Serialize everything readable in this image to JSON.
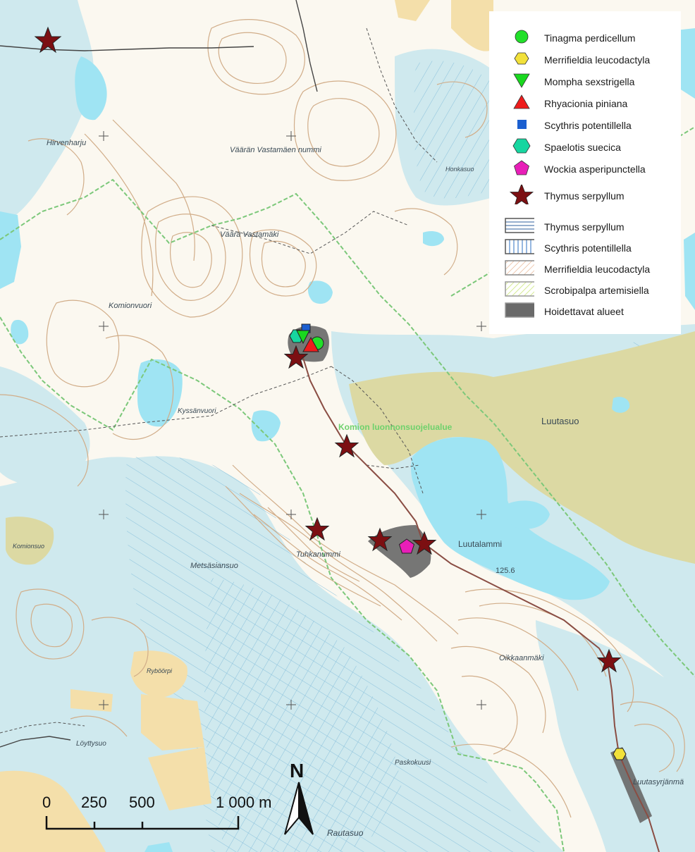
{
  "map": {
    "place_labels": {
      "hirvenharju": "Hirvenharju",
      "vaaran_vastamaen_nummi": "Väärän Vastamäen nummi",
      "vaara_vastamaki": "Väärä Vastamäki",
      "komionvuori": "Komionvuori",
      "honkasuo": "Honkasuo",
      "kyssanvuori": "Kyssänvuori",
      "luutasuo": "Luutasuo",
      "komion_luonnonsuojelualue": "Komion luonnonsuojelualue",
      "komionsuo": "Komionsuo",
      "metsasiansuo": "Metsäsiansuo",
      "tuhkanummi": "Tuhkanummi",
      "luutalammi": "Luutalammi",
      "lake_level": "125.6",
      "oikkaanmaki": "Oikkaanmäki",
      "rybiorpi": "Ryböörpi",
      "loyttysuo": "Löyttysuo",
      "paskokuusi": "Paskokuusi",
      "rautasuo": "Rautasuo",
      "luutasyrjanma": "Luutasyrjänmä"
    },
    "species_markers": [
      {
        "species": "Tinagma perdicellum",
        "shape": "circle",
        "color": "#22e02a"
      },
      {
        "species": "Merrifieldia leucodactyla",
        "shape": "hexagon",
        "color": "#f2e13a"
      },
      {
        "species": "Mompha sexstrigella",
        "shape": "triangle-down",
        "color": "#19d81f"
      },
      {
        "species": "Rhyacionia piniana",
        "shape": "triangle-up",
        "color": "#ee1c1c"
      },
      {
        "species": "Scythris potentillella",
        "shape": "square",
        "color": "#1b5fd0"
      },
      {
        "species": "Spaelotis suecica",
        "shape": "hexagon",
        "color": "#17d6a0"
      },
      {
        "species": "Wockia asperipunctella",
        "shape": "pentagon",
        "color": "#e81eb8"
      },
      {
        "species": "Thymus serpyllum",
        "shape": "star",
        "color": "#7c0f12"
      }
    ]
  },
  "legend": {
    "point_items": [
      {
        "label": "Tinagma perdicellum",
        "icon": "green-circle-icon"
      },
      {
        "label": "Merrifieldia leucodactyla",
        "icon": "yellow-hexagon-icon"
      },
      {
        "label": "Mompha sexstrigella",
        "icon": "green-triangle-down-icon"
      },
      {
        "label": "Rhyacionia piniana",
        "icon": "red-triangle-up-icon"
      },
      {
        "label": "Scythris potentillella",
        "icon": "blue-square-icon"
      },
      {
        "label": "Spaelotis suecica",
        "icon": "teal-hexagon-icon"
      },
      {
        "label": "Wockia asperipunctella",
        "icon": "magenta-pentagon-icon"
      },
      {
        "label": "Thymus serpyllum",
        "icon": "dark-red-star-icon"
      }
    ],
    "area_items": [
      {
        "label": "Thymus serpyllum",
        "pattern": "blue horizontal hatch"
      },
      {
        "label": "Scythris potentillella",
        "pattern": "blue vertical hatch"
      },
      {
        "label": "Merrifieldia leucodactyla",
        "pattern": "orange diagonal hatch"
      },
      {
        "label": "Scrobipalpa artemisiella",
        "pattern": "yellow-green diagonal hatch"
      },
      {
        "label": "Hoidettavat alueet",
        "pattern": "solid grey"
      }
    ]
  },
  "scalebar": {
    "t0": "0",
    "t250": "250",
    "t500": "500",
    "t1000": "1 000 m"
  },
  "north_arrow": {
    "label": "N"
  },
  "colors": {
    "land": "#fbf8f0",
    "marsh": "#cfe9ee",
    "water": "#9fe4f3",
    "field": "#dcd9a3",
    "farmland": "#f4dfaa",
    "contour": "#d1ad89",
    "protected_boundary": "#7cc87a",
    "managed_area": "#6a6a6a",
    "route": "#8a4d43"
  }
}
